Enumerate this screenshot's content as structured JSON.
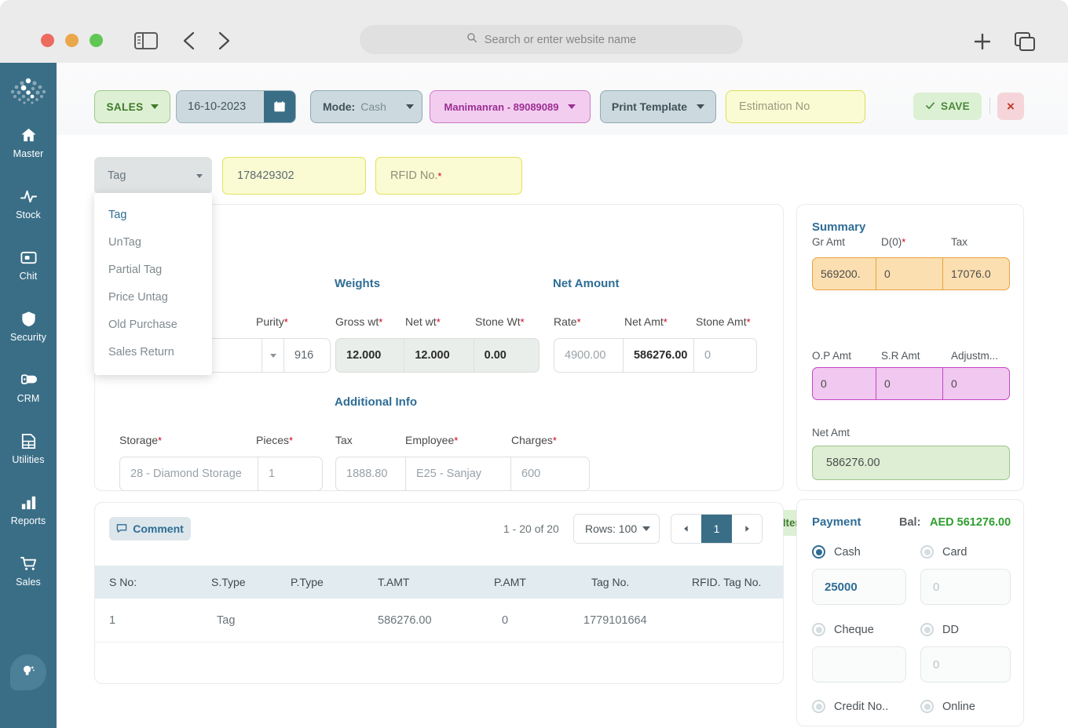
{
  "browser": {
    "address_placeholder": "Search or enter website name",
    "icons": {
      "sidebar_toggle": "sidebar-toggle-icon",
      "back": "chevron-left-icon",
      "forward": "chevron-right-icon",
      "search": "search-icon",
      "new_tab": "plus-icon",
      "tab_overview": "tab-overview-icon"
    }
  },
  "sidebar": {
    "items": [
      {
        "label": "Master",
        "icon": "home-icon"
      },
      {
        "label": "Stock",
        "icon": "pulse-icon"
      },
      {
        "label": "Chit",
        "icon": "chit-card-icon"
      },
      {
        "label": "Security",
        "icon": "shield-icon"
      },
      {
        "label": "CRM",
        "icon": "crm-icon"
      },
      {
        "label": "Utilities",
        "icon": "grid-file-icon"
      },
      {
        "label": "Reports",
        "icon": "bar-chart-icon"
      },
      {
        "label": "Sales",
        "icon": "cart-icon"
      }
    ],
    "help_icon": "lightbulb-icon"
  },
  "toolbar": {
    "module_label": "SALES",
    "date_value": "16-10-2023",
    "calendar_icon": "calendar-icon",
    "mode_key": "Mode:",
    "mode_value": "Cash",
    "customer_label": "Manimanran - 89089089",
    "print_template_label": "Print Template",
    "estimation_placeholder": "Estimation No",
    "save_label": "SAVE",
    "save_icon": "check-icon",
    "close_label": "×"
  },
  "tag_row": {
    "select_value": "Tag",
    "tag_no_value": "178429302",
    "rfid_label": "RFID No.",
    "rfid_required": "*"
  },
  "tag_dropdown": {
    "options": [
      {
        "label": "Tag",
        "selected": true
      },
      {
        "label": "UnTag",
        "selected": false
      },
      {
        "label": "Partial Tag",
        "selected": false
      },
      {
        "label": "Price Untag",
        "selected": false
      },
      {
        "label": "Old Purchase",
        "selected": false
      },
      {
        "label": "Sales Return",
        "selected": false
      }
    ]
  },
  "item_form": {
    "sections": {
      "weights": "Weights",
      "net_amount": "Net Amount",
      "additional_info": "Additional Info"
    },
    "labels": {
      "purity": "Purity",
      "gross_wt": "Gross wt",
      "net_wt": "Net wt",
      "stone_wt": "Stone Wt",
      "rate": "Rate",
      "net_amt": "Net Amt",
      "stone_amt": "Stone Amt",
      "storage": "Storage",
      "pieces": "Pieces",
      "tax": "Tax",
      "employee": "Employee",
      "charges": "Charges"
    },
    "values": {
      "purity": "916",
      "gross_wt": "12.000",
      "net_wt": "12.000",
      "stone_wt": "0.00",
      "rate": "4900.00",
      "net_amt": "586276.00",
      "stone_amt": "0",
      "storage": "28 - Diamond Storage",
      "pieces": "1",
      "tax": "1888.80",
      "employee": "E25 - Sanjay",
      "charges": "600"
    },
    "save_item_label": "Save Item",
    "save_item_icon": "check-icon"
  },
  "summary": {
    "title": "Summary",
    "labels": {
      "gr_amt": "Gr Amt",
      "discount": "D(0)",
      "tax": "Tax",
      "op_amt": "O.P Amt",
      "sr_amt": "S.R Amt",
      "adjustment": "Adjustm...",
      "net_amt": "Net Amt"
    },
    "values": {
      "gr_amt": "569200.",
      "discount": "0",
      "tax": "17076.0",
      "op_amt": "0",
      "sr_amt": "0",
      "adjustment": "0",
      "net_amt": "586276.00"
    }
  },
  "payment": {
    "title": "Payment",
    "balance_label": "Bal:",
    "balance_value": "AED 561276.00",
    "options": [
      {
        "label": "Cash",
        "checked": true,
        "value": "25000",
        "placeholder": ""
      },
      {
        "label": "Card",
        "checked": false,
        "value": "",
        "placeholder": "0"
      },
      {
        "label": "Cheque",
        "checked": false,
        "value": "",
        "placeholder": ""
      },
      {
        "label": "DD",
        "checked": false,
        "value": "",
        "placeholder": "0"
      },
      {
        "label": "Credit No..",
        "checked": false,
        "value": "",
        "placeholder": ""
      },
      {
        "label": "Online",
        "checked": false,
        "value": "",
        "placeholder": ""
      }
    ]
  },
  "item_list": {
    "comment_label": "Comment",
    "comment_icon": "comment-icon",
    "range_text": "1 - 20 of 20",
    "rows_label": "Rows: 100",
    "page_prev_icon": "chevron-left-icon",
    "page_next_icon": "chevron-right-icon",
    "current_page": "1",
    "columns": [
      "S No:",
      "S.Type",
      "P.Type",
      "T.AMT",
      "P.AMT",
      "Tag No.",
      "RFID. Tag No."
    ],
    "rows": [
      {
        "s_no": "1",
        "s_type": "Tag",
        "p_type": "",
        "t_amt": "586276.00",
        "p_amt": "0",
        "tag_no": "1779101664",
        "rfid_tag_no": ""
      }
    ]
  },
  "colors": {
    "sidebar": "#3a6e87",
    "accent": "#2e6d95",
    "success": "#3d7a29",
    "warn_fill": "#fcdfb0",
    "magenta_fill": "#f0c8f0",
    "yellow_fill": "#fafbd3",
    "green_fill": "#ddeed4"
  }
}
